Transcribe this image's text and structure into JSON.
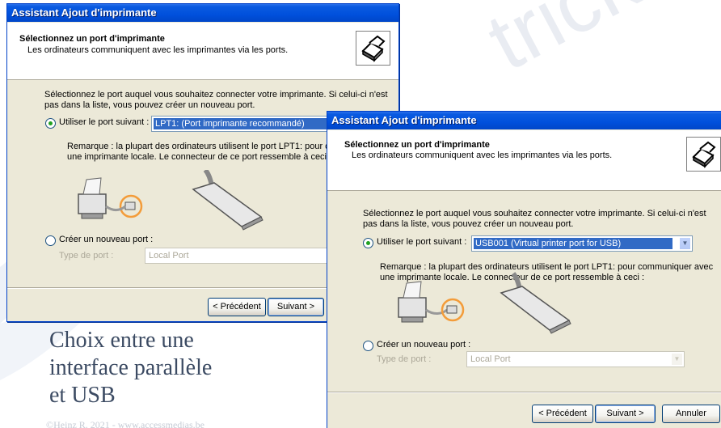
{
  "watermark": "trick",
  "caption": {
    "line1": "Choix entre une",
    "line2": "interface parallèle",
    "line3": "et USB"
  },
  "copyright": "©Heinz R. 2021 - www.accessmedias.be",
  "dialog_back": {
    "title": "Assistant Ajout d'imprimante",
    "header_title": "Sélectionnez un port d'imprimante",
    "header_subtitle": "Les ordinateurs communiquent avec les imprimantes via les ports.",
    "intro_line1": "Sélectionnez le port auquel vous souhaitez connecter votre imprimante. Si celui-ci n'est",
    "intro_line2": "pas dans la liste, vous pouvez créer un nouveau port.",
    "use_port_label": "Utiliser le port suivant :",
    "use_port_value": "LPT1: (Port imprimante recommandé)",
    "note_line1": "Remarque : la plupart des ordinateurs utilisent le port LPT1: pour commun",
    "note_line2": "une imprimante locale. Le connecteur de ce port ressemble à ceci :",
    "new_port_label": "Créer un nouveau port :",
    "port_type_label": "Type de port :",
    "port_type_value": "Local Port",
    "back_button": "< Précédent",
    "next_button": "Suivant >"
  },
  "dialog_front": {
    "title": "Assistant Ajout d'imprimante",
    "header_title": "Sélectionnez un port d'imprimante",
    "header_subtitle": "Les ordinateurs communiquent avec les imprimantes via les ports.",
    "intro_line1": "Sélectionnez le port auquel vous souhaitez connecter votre imprimante. Si celui-ci n'est",
    "intro_line2": "pas dans la liste, vous pouvez créer un nouveau port.",
    "use_port_label": "Utiliser le port suivant :",
    "use_port_value": "USB001 (Virtual printer port for USB)",
    "note_line1": "Remarque : la plupart des ordinateurs utilisent le port LPT1: pour communiquer avec",
    "note_line2": "une imprimante locale. Le connecteur de ce port ressemble à ceci :",
    "new_port_label": "Créer un nouveau port :",
    "port_type_label": "Type de port :",
    "port_type_value": "Local Port",
    "back_button": "< Précédent",
    "next_button": "Suivant >",
    "cancel_button": "Annuler"
  },
  "colors": {
    "titlebar": "#0050dc",
    "dialog_bg": "#ece9d8",
    "selection": "#316ac5",
    "radio_dot": "#21a121",
    "highlight_ring": "#f39c3a",
    "caption": "#3c4b63"
  },
  "icons": {
    "header": "printer-wizard-icon",
    "illustration": "printer-parallel-cable-icon",
    "dropdown": "chevron-down-icon"
  }
}
